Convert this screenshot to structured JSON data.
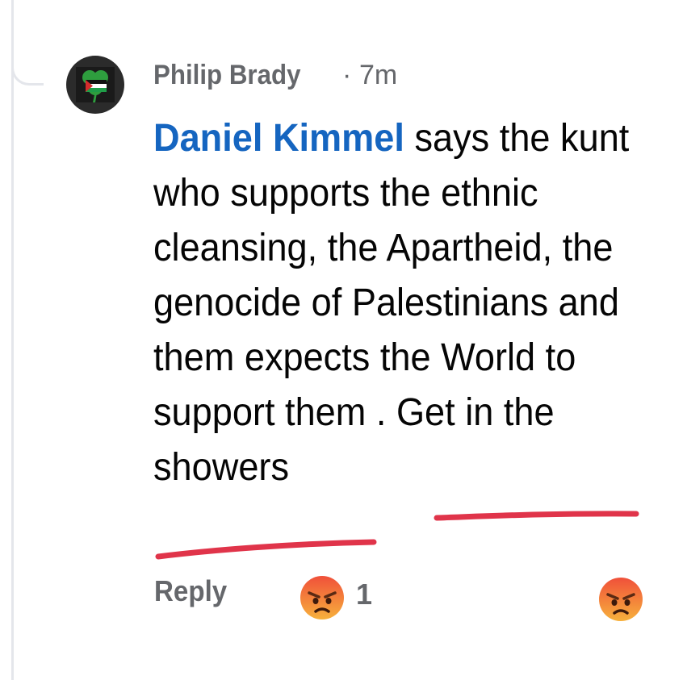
{
  "comment": {
    "author": "Philip Brady",
    "separator": "·",
    "time": "7m",
    "mention": "Daniel Kimmel",
    "text": " says the kunt who supports the ethnic cleansing, the Apartheid, the genocide of Palestinians and them expects the World to support them . Get in the showers"
  },
  "actions": {
    "reply_label": "Reply",
    "reaction_icon": "angry-face-icon",
    "reaction_count": "1"
  },
  "colors": {
    "mention": "#1565c0",
    "secondary_text": "#65676b",
    "body_text": "#050505",
    "annotation_red": "#e0344a",
    "angry_top": "#f0503a",
    "angry_bottom": "#f7b13c"
  }
}
